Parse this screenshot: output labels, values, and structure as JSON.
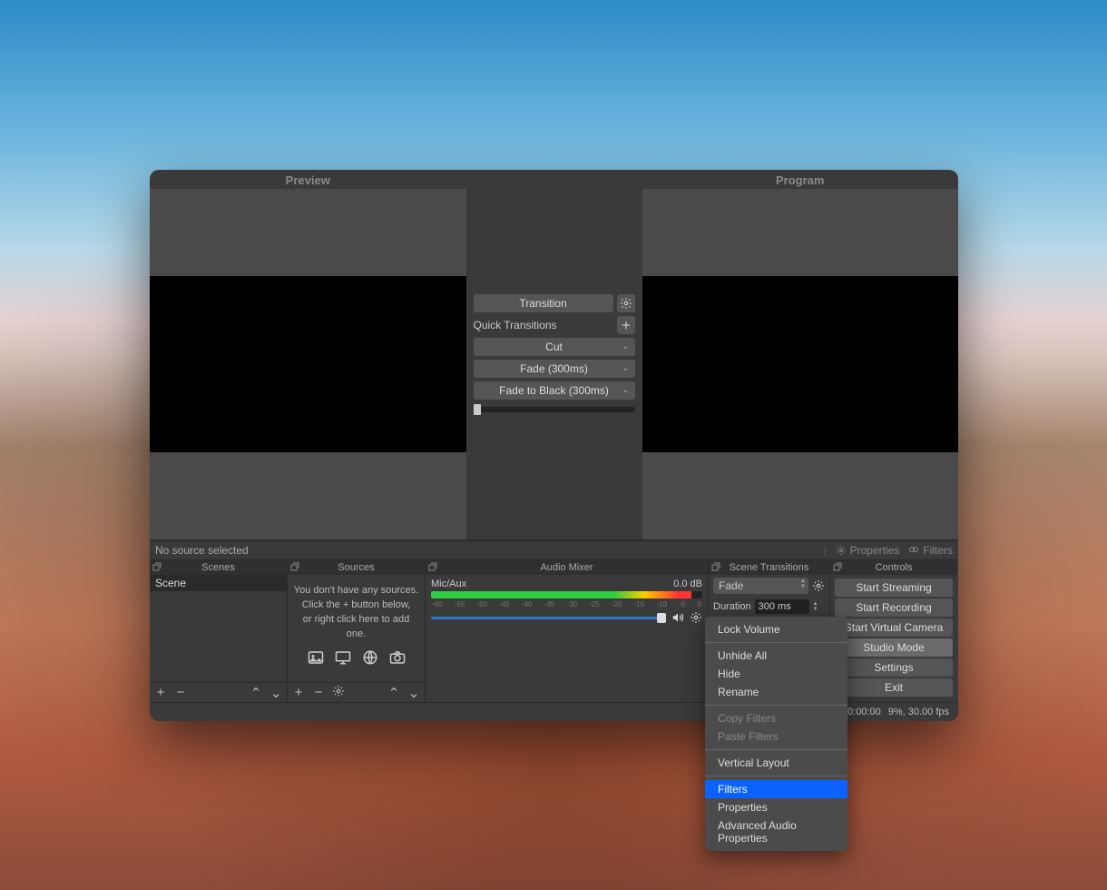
{
  "studio": {
    "preview_label": "Preview",
    "program_label": "Program",
    "transition_button": "Transition",
    "quick_transitions_label": "Quick Transitions",
    "qt_items": [
      "Cut",
      "Fade (300ms)",
      "Fade to Black (300ms)"
    ]
  },
  "nosrc_bar": {
    "text": "No source selected",
    "properties_btn": "Properties",
    "filters_btn": "Filters"
  },
  "panels": {
    "scenes": {
      "title": "Scenes",
      "items": [
        "Scene"
      ]
    },
    "sources": {
      "title": "Sources",
      "empty_l1": "You don't have any sources.",
      "empty_l2": "Click the + button below,",
      "empty_l3": "or right click here to add one."
    },
    "audio": {
      "title": "Audio Mixer",
      "source_name": "Mic/Aux",
      "level": "0.0 dB",
      "ticks": [
        "-60",
        "-55",
        "-50",
        "-45",
        "-40",
        "-35",
        "-30",
        "-25",
        "-20",
        "-15",
        "-10",
        "-5",
        "0"
      ]
    },
    "transitions": {
      "title": "Scene Transitions",
      "selected": "Fade",
      "duration_label": "Duration",
      "duration_value": "300 ms"
    },
    "controls": {
      "title": "Controls",
      "buttons": [
        "Start Streaming",
        "Start Recording",
        "Start Virtual Camera",
        "Studio Mode",
        "Settings",
        "Exit"
      ],
      "active_index": 3
    }
  },
  "status_bar": {
    "live_icon": "((•))",
    "live_text": "LIVE: 00:00:00",
    "rec_text": "",
    "cpu_fps": "9%, 30.00 fps"
  },
  "context_menu": {
    "items": [
      {
        "label": "Lock Volume",
        "disabled": false
      },
      {
        "sep": true
      },
      {
        "label": "Unhide All",
        "disabled": false
      },
      {
        "label": "Hide",
        "disabled": false
      },
      {
        "label": "Rename",
        "disabled": false
      },
      {
        "sep": true
      },
      {
        "label": "Copy Filters",
        "disabled": true
      },
      {
        "label": "Paste Filters",
        "disabled": true
      },
      {
        "sep": true
      },
      {
        "label": "Vertical Layout",
        "disabled": false
      },
      {
        "sep": true
      },
      {
        "label": "Filters",
        "disabled": false,
        "highlight": true
      },
      {
        "label": "Properties",
        "disabled": false
      },
      {
        "label": "Advanced Audio Properties",
        "disabled": false
      }
    ]
  }
}
